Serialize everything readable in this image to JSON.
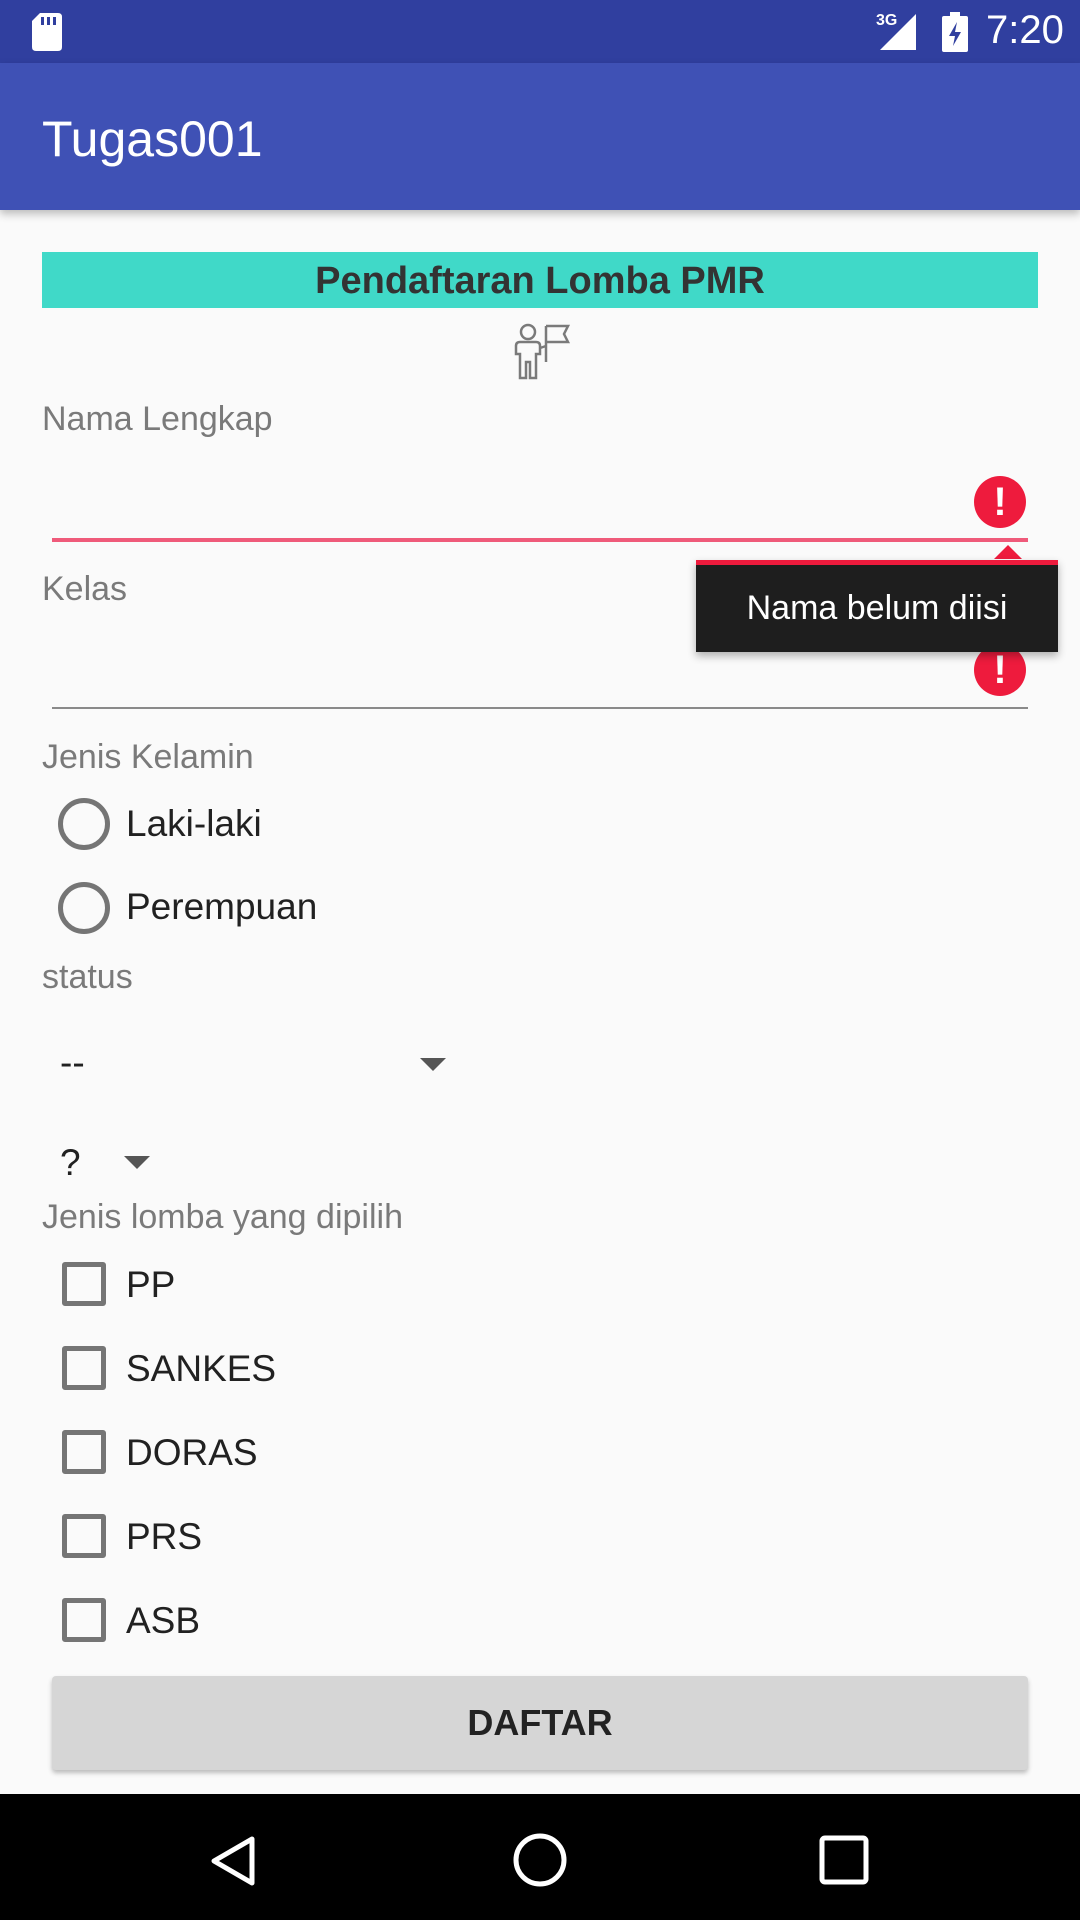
{
  "status_bar": {
    "time": "7:20",
    "network": "3G",
    "icons": [
      "sd-card-icon",
      "signal-icon",
      "battery-icon"
    ]
  },
  "toolbar": {
    "title": "Tugas001"
  },
  "form": {
    "header": "Pendaftaran Lomba PMR",
    "logo_icon": "person-flag-icon",
    "nama": {
      "label": "Nama Lengkap",
      "value": "",
      "error": "Nama belum diisi"
    },
    "kelas": {
      "label": "Kelas",
      "value": ""
    },
    "jenis_kelamin": {
      "label": "Jenis Kelamin",
      "options": [
        "Laki-laki",
        "Perempuan"
      ]
    },
    "status": {
      "label": "status",
      "spinner1_value": "--",
      "spinner2_value": "?"
    },
    "lomba": {
      "label": "Jenis lomba yang dipilih",
      "options": [
        "PP",
        "SANKES",
        "DORAS",
        "PRS",
        "ASB"
      ]
    },
    "submit_label": "DAFTAR"
  },
  "colors": {
    "status_bar": "#303f9f",
    "toolbar": "#3f51b5",
    "banner": "#40d9c8",
    "error": "#ee1b3d"
  }
}
